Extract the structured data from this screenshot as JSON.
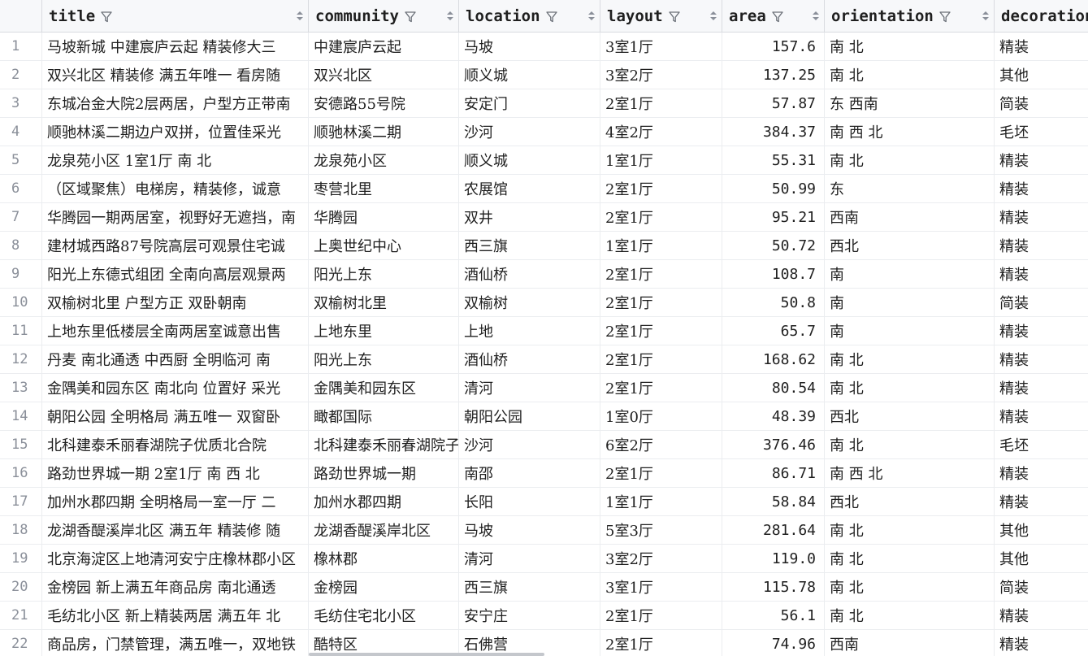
{
  "columns": [
    {
      "key": "title",
      "label": "title",
      "cls": "c-title"
    },
    {
      "key": "community",
      "label": "community",
      "cls": "c-community"
    },
    {
      "key": "location",
      "label": "location",
      "cls": "c-location"
    },
    {
      "key": "layout",
      "label": "layout",
      "cls": "c-layout"
    },
    {
      "key": "area",
      "label": "area",
      "cls": "c-area"
    },
    {
      "key": "orientation",
      "label": "orientation",
      "cls": "c-orientation"
    },
    {
      "key": "decoration",
      "label": "decoration",
      "cls": "c-decoration"
    }
  ],
  "icons": {
    "filter": "funnel-icon",
    "sort": "sort-icon"
  },
  "rows": [
    {
      "n": "1",
      "title": "马坡新城  中建宸庐云起  精装修大三",
      "community": "中建宸庐云起",
      "location": "马坡",
      "layout": "3室1厅",
      "area": "157.6",
      "orientation": "南 北",
      "decoration": "精装"
    },
    {
      "n": "2",
      "title": "双兴北区  精装修  满五年唯一  看房随",
      "community": "双兴北区",
      "location": "顺义城",
      "layout": "3室2厅",
      "area": "137.25",
      "orientation": "南 北",
      "decoration": "其他"
    },
    {
      "n": "3",
      "title": "东城冶金大院2层两居，户型方正带南",
      "community": "安德路55号院",
      "location": "安定门",
      "layout": "2室1厅",
      "area": "57.87",
      "orientation": "东 西南",
      "decoration": "简装"
    },
    {
      "n": "4",
      "title": "顺驰林溪二期边户双拼，位置佳采光",
      "community": "顺驰林溪二期",
      "location": "沙河",
      "layout": "4室2厅",
      "area": "384.37",
      "orientation": "南 西 北",
      "decoration": "毛坯"
    },
    {
      "n": "5",
      "title": "龙泉苑小区  1室1厅  南  北",
      "community": "龙泉苑小区",
      "location": "顺义城",
      "layout": "1室1厅",
      "area": "55.31",
      "orientation": "南 北",
      "decoration": "精装"
    },
    {
      "n": "6",
      "title": "（区域聚焦）电梯房，精装修，诚意",
      "community": "枣营北里",
      "location": "农展馆",
      "layout": "2室1厅",
      "area": "50.99",
      "orientation": "东",
      "decoration": "精装"
    },
    {
      "n": "7",
      "title": "华腾园一期两居室，视野好无遮挡，南",
      "community": "华腾园",
      "location": "双井",
      "layout": "2室1厅",
      "area": "95.21",
      "orientation": "西南",
      "decoration": "精装"
    },
    {
      "n": "8",
      "title": "建材城西路87号院高层可观景住宅诚",
      "community": "上奥世纪中心",
      "location": "西三旗",
      "layout": "1室1厅",
      "area": "50.72",
      "orientation": "西北",
      "decoration": "精装"
    },
    {
      "n": "9",
      "title": "阳光上东德式组团  全南向高层观景两",
      "community": "阳光上东",
      "location": "酒仙桥",
      "layout": "2室1厅",
      "area": "108.7",
      "orientation": "南",
      "decoration": "精装"
    },
    {
      "n": "10",
      "title": "双榆树北里  户型方正  双卧朝南",
      "community": "双榆树北里",
      "location": "双榆树",
      "layout": "2室1厅",
      "area": "50.8",
      "orientation": "南",
      "decoration": "简装"
    },
    {
      "n": "11",
      "title": "上地东里低楼层全南两居室诚意出售",
      "community": "上地东里",
      "location": "上地",
      "layout": "2室1厅",
      "area": "65.7",
      "orientation": "南",
      "decoration": "精装"
    },
    {
      "n": "12",
      "title": "丹麦  南北通透  中西厨    全明临河  南",
      "community": "阳光上东",
      "location": "酒仙桥",
      "layout": "2室1厅",
      "area": "168.62",
      "orientation": "南 北",
      "decoration": "精装"
    },
    {
      "n": "13",
      "title": "金隅美和园东区  南北向  位置好  采光",
      "community": "金隅美和园东区",
      "location": "清河",
      "layout": "2室1厅",
      "area": "80.54",
      "orientation": "南 北",
      "decoration": "精装"
    },
    {
      "n": "14",
      "title": "朝阳公园  全明格局  满五唯一  双窗卧",
      "community": "瞰都国际",
      "location": "朝阳公园",
      "layout": "1室0厅",
      "area": "48.39",
      "orientation": "西北",
      "decoration": "精装"
    },
    {
      "n": "15",
      "title": "北科建泰禾丽春湖院子优质北合院",
      "community": "北科建泰禾丽春湖院子",
      "location": "沙河",
      "layout": "6室2厅",
      "area": "376.46",
      "orientation": "南 北",
      "decoration": "毛坯"
    },
    {
      "n": "16",
      "title": "路劲世界城一期  2室1厅  南  西  北",
      "community": "路劲世界城一期",
      "location": "南邵",
      "layout": "2室1厅",
      "area": "86.71",
      "orientation": "南 西 北",
      "decoration": "精装"
    },
    {
      "n": "17",
      "title": "加州水郡四期  全明格局一室一厅  二",
      "community": "加州水郡四期",
      "location": "长阳",
      "layout": "1室1厅",
      "area": "58.84",
      "orientation": "西北",
      "decoration": "精装"
    },
    {
      "n": "18",
      "title": "龙湖香醍溪岸北区  满五年  精装修  随",
      "community": "龙湖香醍溪岸北区",
      "location": "马坡",
      "layout": "5室3厅",
      "area": "281.64",
      "orientation": "南 北",
      "decoration": "其他"
    },
    {
      "n": "19",
      "title": "北京海淀区上地清河安宁庄橡林郡小区",
      "community": "橡林郡",
      "location": "清河",
      "layout": "3室2厅",
      "area": "119.0",
      "orientation": "南 北",
      "decoration": "其他"
    },
    {
      "n": "20",
      "title": "金榜园  新上满五年商品房  南北通透",
      "community": "金榜园",
      "location": "西三旗",
      "layout": "3室1厅",
      "area": "115.78",
      "orientation": "南 北",
      "decoration": "简装"
    },
    {
      "n": "21",
      "title": "毛纺北小区  新上精装两居  满五年  北",
      "community": "毛纺住宅北小区",
      "location": "安宁庄",
      "layout": "2室1厅",
      "area": "56.1",
      "orientation": "南 北",
      "decoration": "精装"
    },
    {
      "n": "22",
      "title": "商品房，门禁管理，满五唯一，双地铁",
      "community": "酷特区",
      "location": "石佛营",
      "layout": "2室1厅",
      "area": "74.96",
      "orientation": "西南",
      "decoration": "精装"
    }
  ]
}
